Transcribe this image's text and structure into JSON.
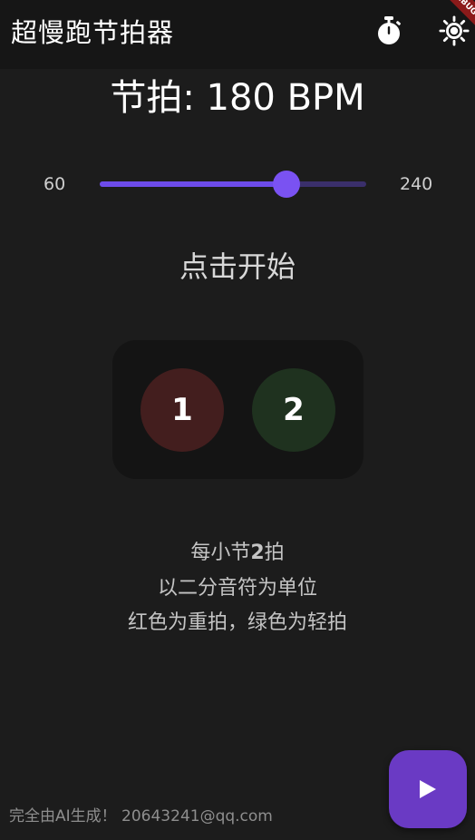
{
  "app_bar": {
    "title": "超慢跑节拍器",
    "timer_icon": "stopwatch-icon",
    "theme_icon": "sun-icon",
    "debug_banner": "DEBUG"
  },
  "tempo": {
    "label": "节拍: 180 BPM",
    "bpm": 180,
    "min": 60,
    "max": 240,
    "min_label": "60",
    "max_label": "240"
  },
  "status_text": "点击开始",
  "beats": [
    {
      "label": "1",
      "kind": "strong",
      "color": "#431e1e"
    },
    {
      "label": "2",
      "kind": "weak",
      "color": "#1f321f"
    }
  ],
  "info": {
    "beats_prefix": "每小节",
    "beats_count": "2",
    "beats_suffix": "拍",
    "unit_line": "以二分音符为单位",
    "color_line": "红色为重拍，绿色为轻拍"
  },
  "footer_text": "完全由AI生成！ 20643241@qq.com",
  "play_button": {
    "icon": "play-icon"
  },
  "colors": {
    "accent": "#7a52f2",
    "background": "#1c1c1c",
    "fab": "#6a3ac4"
  }
}
